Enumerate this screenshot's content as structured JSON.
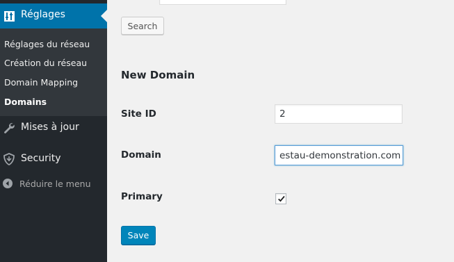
{
  "sidebar": {
    "current_menu": {
      "label": "Réglages",
      "icon": "settings-icon"
    },
    "submenu": [
      {
        "label": "Réglages du réseau"
      },
      {
        "label": "Création du réseau"
      },
      {
        "label": "Domain Mapping"
      },
      {
        "label": "Domains",
        "active": true
      }
    ],
    "items": [
      {
        "label": "Mises à jour",
        "icon": "wrench-icon"
      },
      {
        "label": "Security",
        "icon": "shield-icon"
      }
    ],
    "collapse": {
      "label": "Réduire le menu",
      "icon": "collapse-arrow-icon"
    }
  },
  "search": {
    "value": "",
    "button_label": "Search"
  },
  "form": {
    "title": "New Domain",
    "site_id": {
      "label": "Site ID",
      "value": "2"
    },
    "domain": {
      "label": "Domain",
      "value": "estau-demonstration.com"
    },
    "primary": {
      "label": "Primary",
      "checked": true
    },
    "save_label": "Save"
  },
  "colors": {
    "sidebar_bg": "#23282d",
    "submenu_bg": "#32373c",
    "accent": "#0073aa",
    "primary_button": "#0085ba",
    "page_bg": "#f1f1f1"
  }
}
